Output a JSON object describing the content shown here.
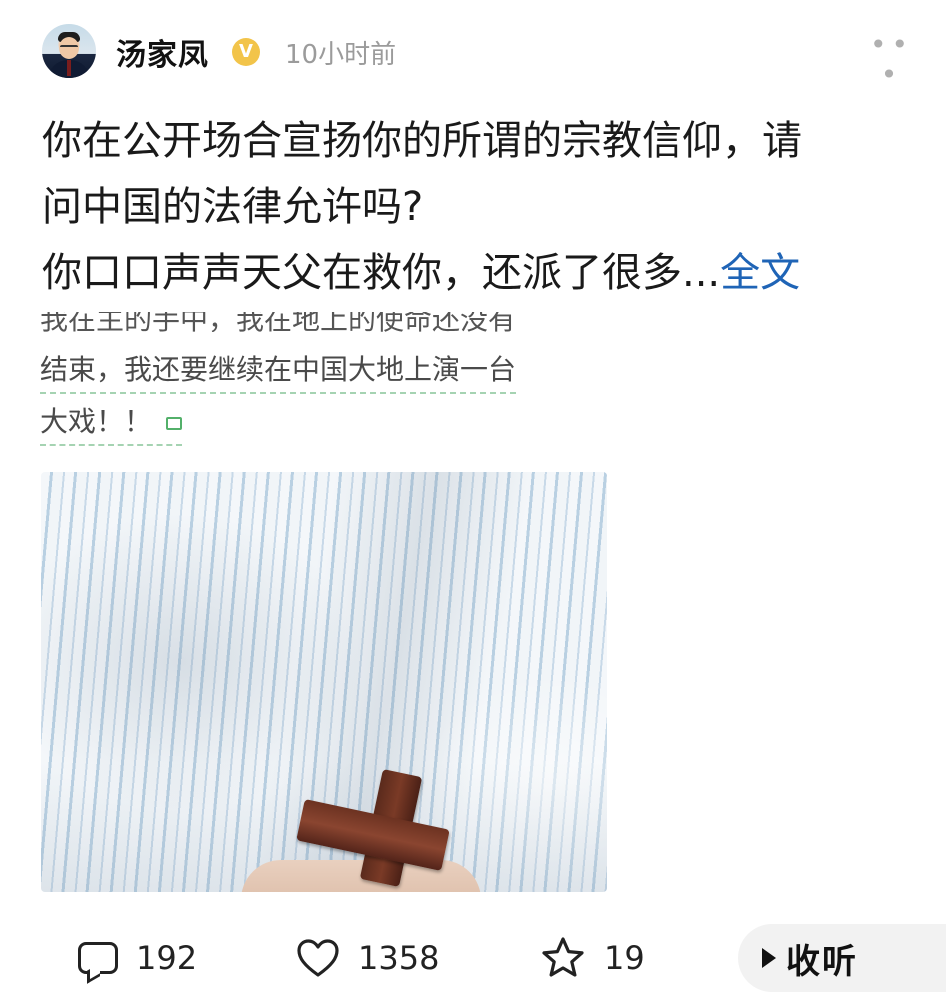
{
  "post": {
    "author": {
      "name": "汤家凤",
      "verified_icon": "verified-badge-icon",
      "time": "10小时前"
    },
    "more_icon": "more-dots-icon",
    "text_lines": [
      "你在公开场合宣扬你的所谓的宗教信仰，请",
      "问中国的法律允许吗?",
      "你口口声声天父在救你，还派了很多..."
    ],
    "read_more_label": "全文",
    "embedded_snippet": {
      "cut_line": "我在主的手中，我在地上的使命还没有",
      "line1": "结束，我还要继续在中国大地上演一台",
      "line2": "大戏！！"
    },
    "image_icon": "photo-striped-shirt-cross"
  },
  "actions": {
    "comment_count": "192",
    "like_count": "1358",
    "favorite_count": "19",
    "listen_label": "收听"
  },
  "colors": {
    "link": "#1f64b6",
    "verified": "#f2c44a",
    "muted": "#9b9b9b"
  }
}
